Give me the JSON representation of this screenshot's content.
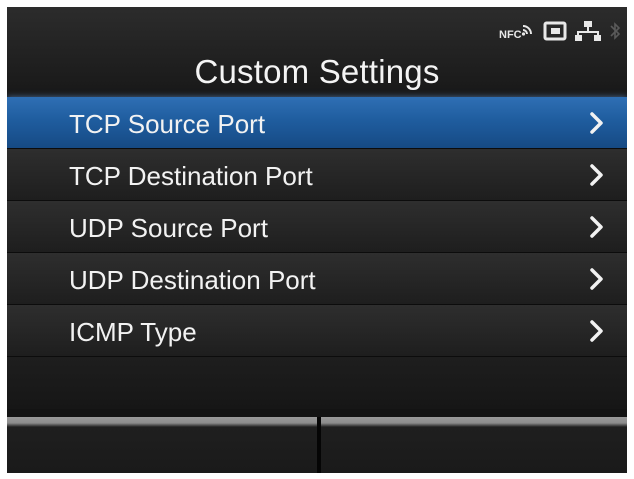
{
  "header": {
    "title": "Custom Settings",
    "status_icons": [
      "nfc-icon",
      "card-icon",
      "network-icon",
      "bluetooth-icon"
    ],
    "nfc_label": "NFC"
  },
  "menu": {
    "items": [
      {
        "label": "TCP Source Port",
        "selected": true
      },
      {
        "label": "TCP Destination Port",
        "selected": false
      },
      {
        "label": "UDP Source Port",
        "selected": false
      },
      {
        "label": "UDP Destination Port",
        "selected": false
      },
      {
        "label": "ICMP Type",
        "selected": false
      }
    ]
  },
  "softkeys": {
    "left_label": "",
    "right_label": ""
  },
  "colors": {
    "selection": "#1f5d9f",
    "background": "#131313",
    "text": "#f2f2f2"
  }
}
